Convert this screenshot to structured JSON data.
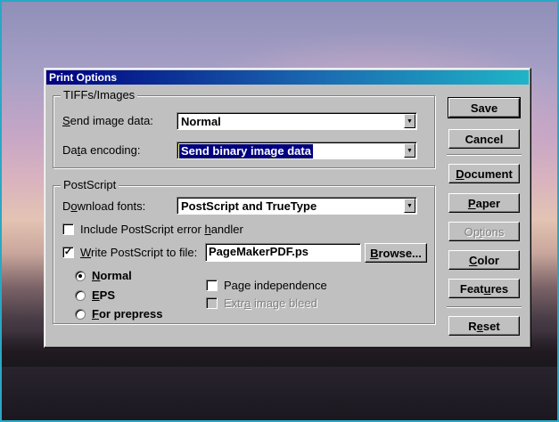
{
  "dialog": {
    "title": "Print Options",
    "tiffs": {
      "group_label": "TIFFs/Images",
      "send_label_u": "S",
      "send_label_rest": "end image data:",
      "send_value": "Normal",
      "enc_label_pre": "Da",
      "enc_label_u": "t",
      "enc_label_post": "a encoding:",
      "enc_value": "Send binary image data"
    },
    "postscript": {
      "group_label": "PostScript",
      "fonts_label_pre": "D",
      "fonts_label_u": "o",
      "fonts_label_post": "wnload fonts:",
      "fonts_value": "PostScript and TrueType",
      "include_pre": "Include PostScript error ",
      "include_u": "h",
      "include_post": "andler",
      "include_checked": false,
      "write_u": "W",
      "write_post": "rite PostScript to file:",
      "write_checked": true,
      "filename": "PageMakerPDF.ps",
      "browse_u": "B",
      "browse_post": "rowse...",
      "radios": [
        {
          "u": "N",
          "rest": "ormal",
          "selected": true
        },
        {
          "u": "E",
          "rest": "PS",
          "selected": false
        },
        {
          "u": "F",
          "rest": "or prepress",
          "selected": false
        }
      ],
      "page_indep_pre": "Pa",
      "page_indep_u": "g",
      "page_indep_post": "e independence",
      "page_indep_checked": false,
      "extra_pre": "Extr",
      "extra_u": "a",
      "extra_post": " image bleed",
      "extra_checked": false,
      "extra_disabled": true
    },
    "buttons": {
      "save": "Save",
      "cancel": "Cancel",
      "document_u": "D",
      "document_rest": "ocument",
      "paper_u": "P",
      "paper_rest": "aper",
      "options_pre": "Op",
      "options_u": "t",
      "options_post": "ions",
      "color_u": "C",
      "color_rest": "olor",
      "features_pre": "Feat",
      "features_u": "u",
      "features_post": "res",
      "reset_pre": "R",
      "reset_u": "e",
      "reset_post": "set"
    },
    "colors": {
      "title_start": "#000080",
      "title_end": "#1fb4c8",
      "face": "#c0c0c0",
      "selection": "#000080"
    }
  }
}
